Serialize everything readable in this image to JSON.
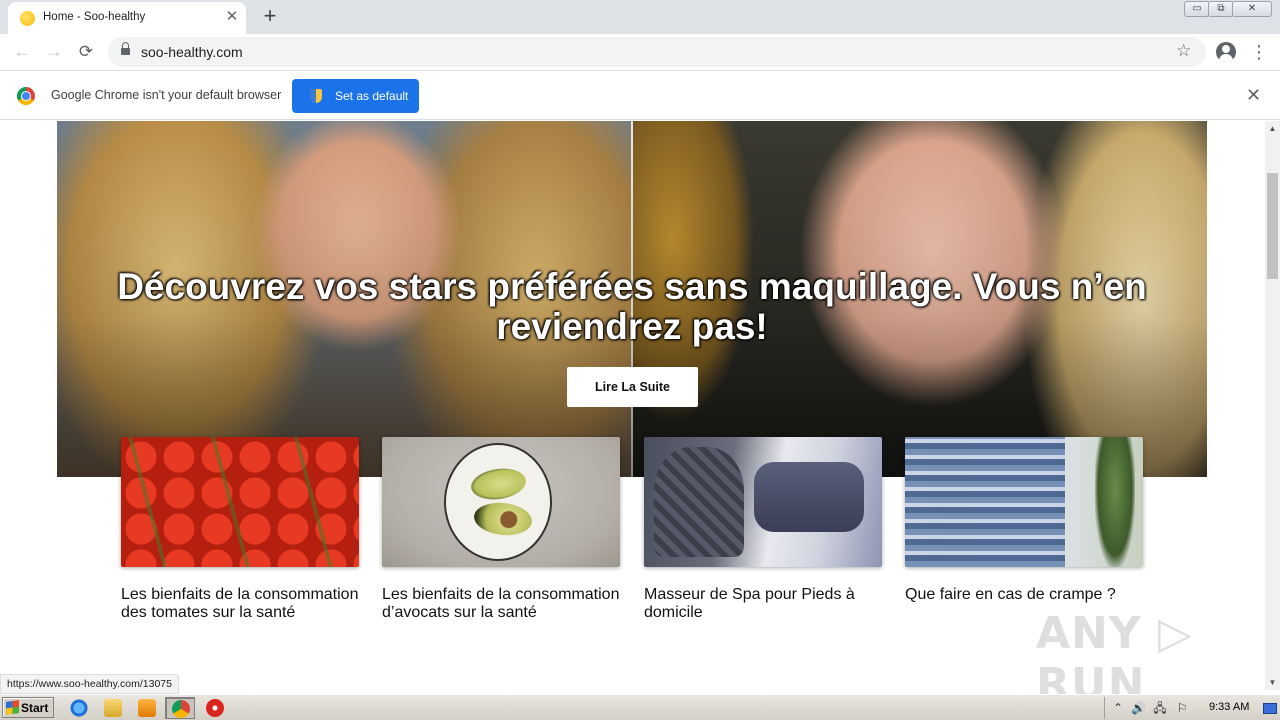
{
  "browser": {
    "tab": {
      "title": "Home - Soo-healthy",
      "close": "✕"
    },
    "new_tab": "+",
    "window_buttons": [
      "▭",
      "⧉",
      "✕"
    ],
    "nav": {
      "back": "←",
      "forward": "→",
      "reload": "⟳"
    },
    "url": "soo-healthy.com",
    "bookmark_star": "☆",
    "menu": "⋮"
  },
  "infobar": {
    "message": "Google Chrome isn't your default browser",
    "button": "Set as default",
    "close": "✕"
  },
  "hero": {
    "title": "Découvrez vos stars préférées sans maquillage. Vous n’en reviendrez pas!",
    "button": "Lire La Suite"
  },
  "cards": [
    {
      "title": "Les bienfaits de la consommation des tomates sur la santé"
    },
    {
      "title": "Les bienfaits de la consommation d’avocats sur la santé"
    },
    {
      "title": "Masseur de Spa pour Pieds à domicile"
    },
    {
      "title": "Que faire en cas de crampe ?"
    }
  ],
  "status_url": "https://www.soo-healthy.com/13075",
  "watermark": "ANY ▷ RUN",
  "scrollbar": {
    "up": "▲",
    "down": "▼"
  },
  "taskbar": {
    "start": "Start",
    "clock": "9:33 AM",
    "tray_icons": [
      "⌃",
      "🔊",
      "🖧",
      "⚐"
    ]
  }
}
